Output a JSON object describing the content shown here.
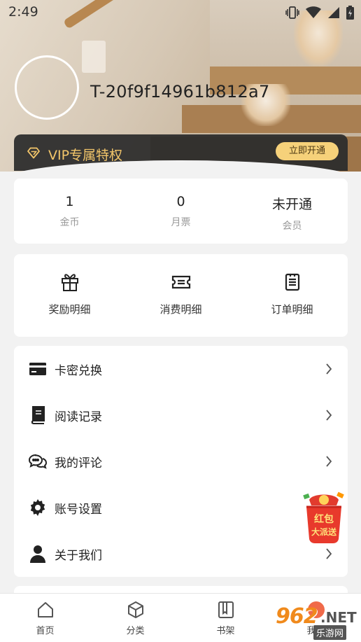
{
  "status_bar": {
    "time": "2:49"
  },
  "profile": {
    "user_id": "T-20f9f14961b812a7"
  },
  "vip": {
    "label": "VIP专属特权",
    "button": "立即开通",
    "accent": "#f3c66a"
  },
  "stats": [
    {
      "value": "1",
      "label": "金币"
    },
    {
      "value": "0",
      "label": "月票"
    },
    {
      "value": "未开通",
      "label": "会员"
    }
  ],
  "quick_links": [
    {
      "label": "奖励明细",
      "icon": "gift-icon"
    },
    {
      "label": "消费明细",
      "icon": "ticket-icon"
    },
    {
      "label": "订单明细",
      "icon": "clipboard-icon"
    }
  ],
  "menu": [
    {
      "label": "卡密兑换",
      "icon": "card-icon"
    },
    {
      "label": "阅读记录",
      "icon": "book-icon"
    },
    {
      "label": "我的评论",
      "icon": "comments-icon"
    },
    {
      "label": "账号设置",
      "icon": "gear-icon"
    },
    {
      "label": "关于我们",
      "icon": "user-icon"
    }
  ],
  "floating_badge": {
    "line1": "红包",
    "line2": "大派送"
  },
  "tabbar": [
    {
      "label": "首页",
      "icon": "home-icon"
    },
    {
      "label": "分类",
      "icon": "cube-icon"
    },
    {
      "label": "书架",
      "icon": "bookshelf-icon"
    },
    {
      "label": "我的",
      "icon": "profile-icon"
    }
  ],
  "watermark": {
    "number": "962",
    "domain": ".NET",
    "site": "乐游网"
  }
}
